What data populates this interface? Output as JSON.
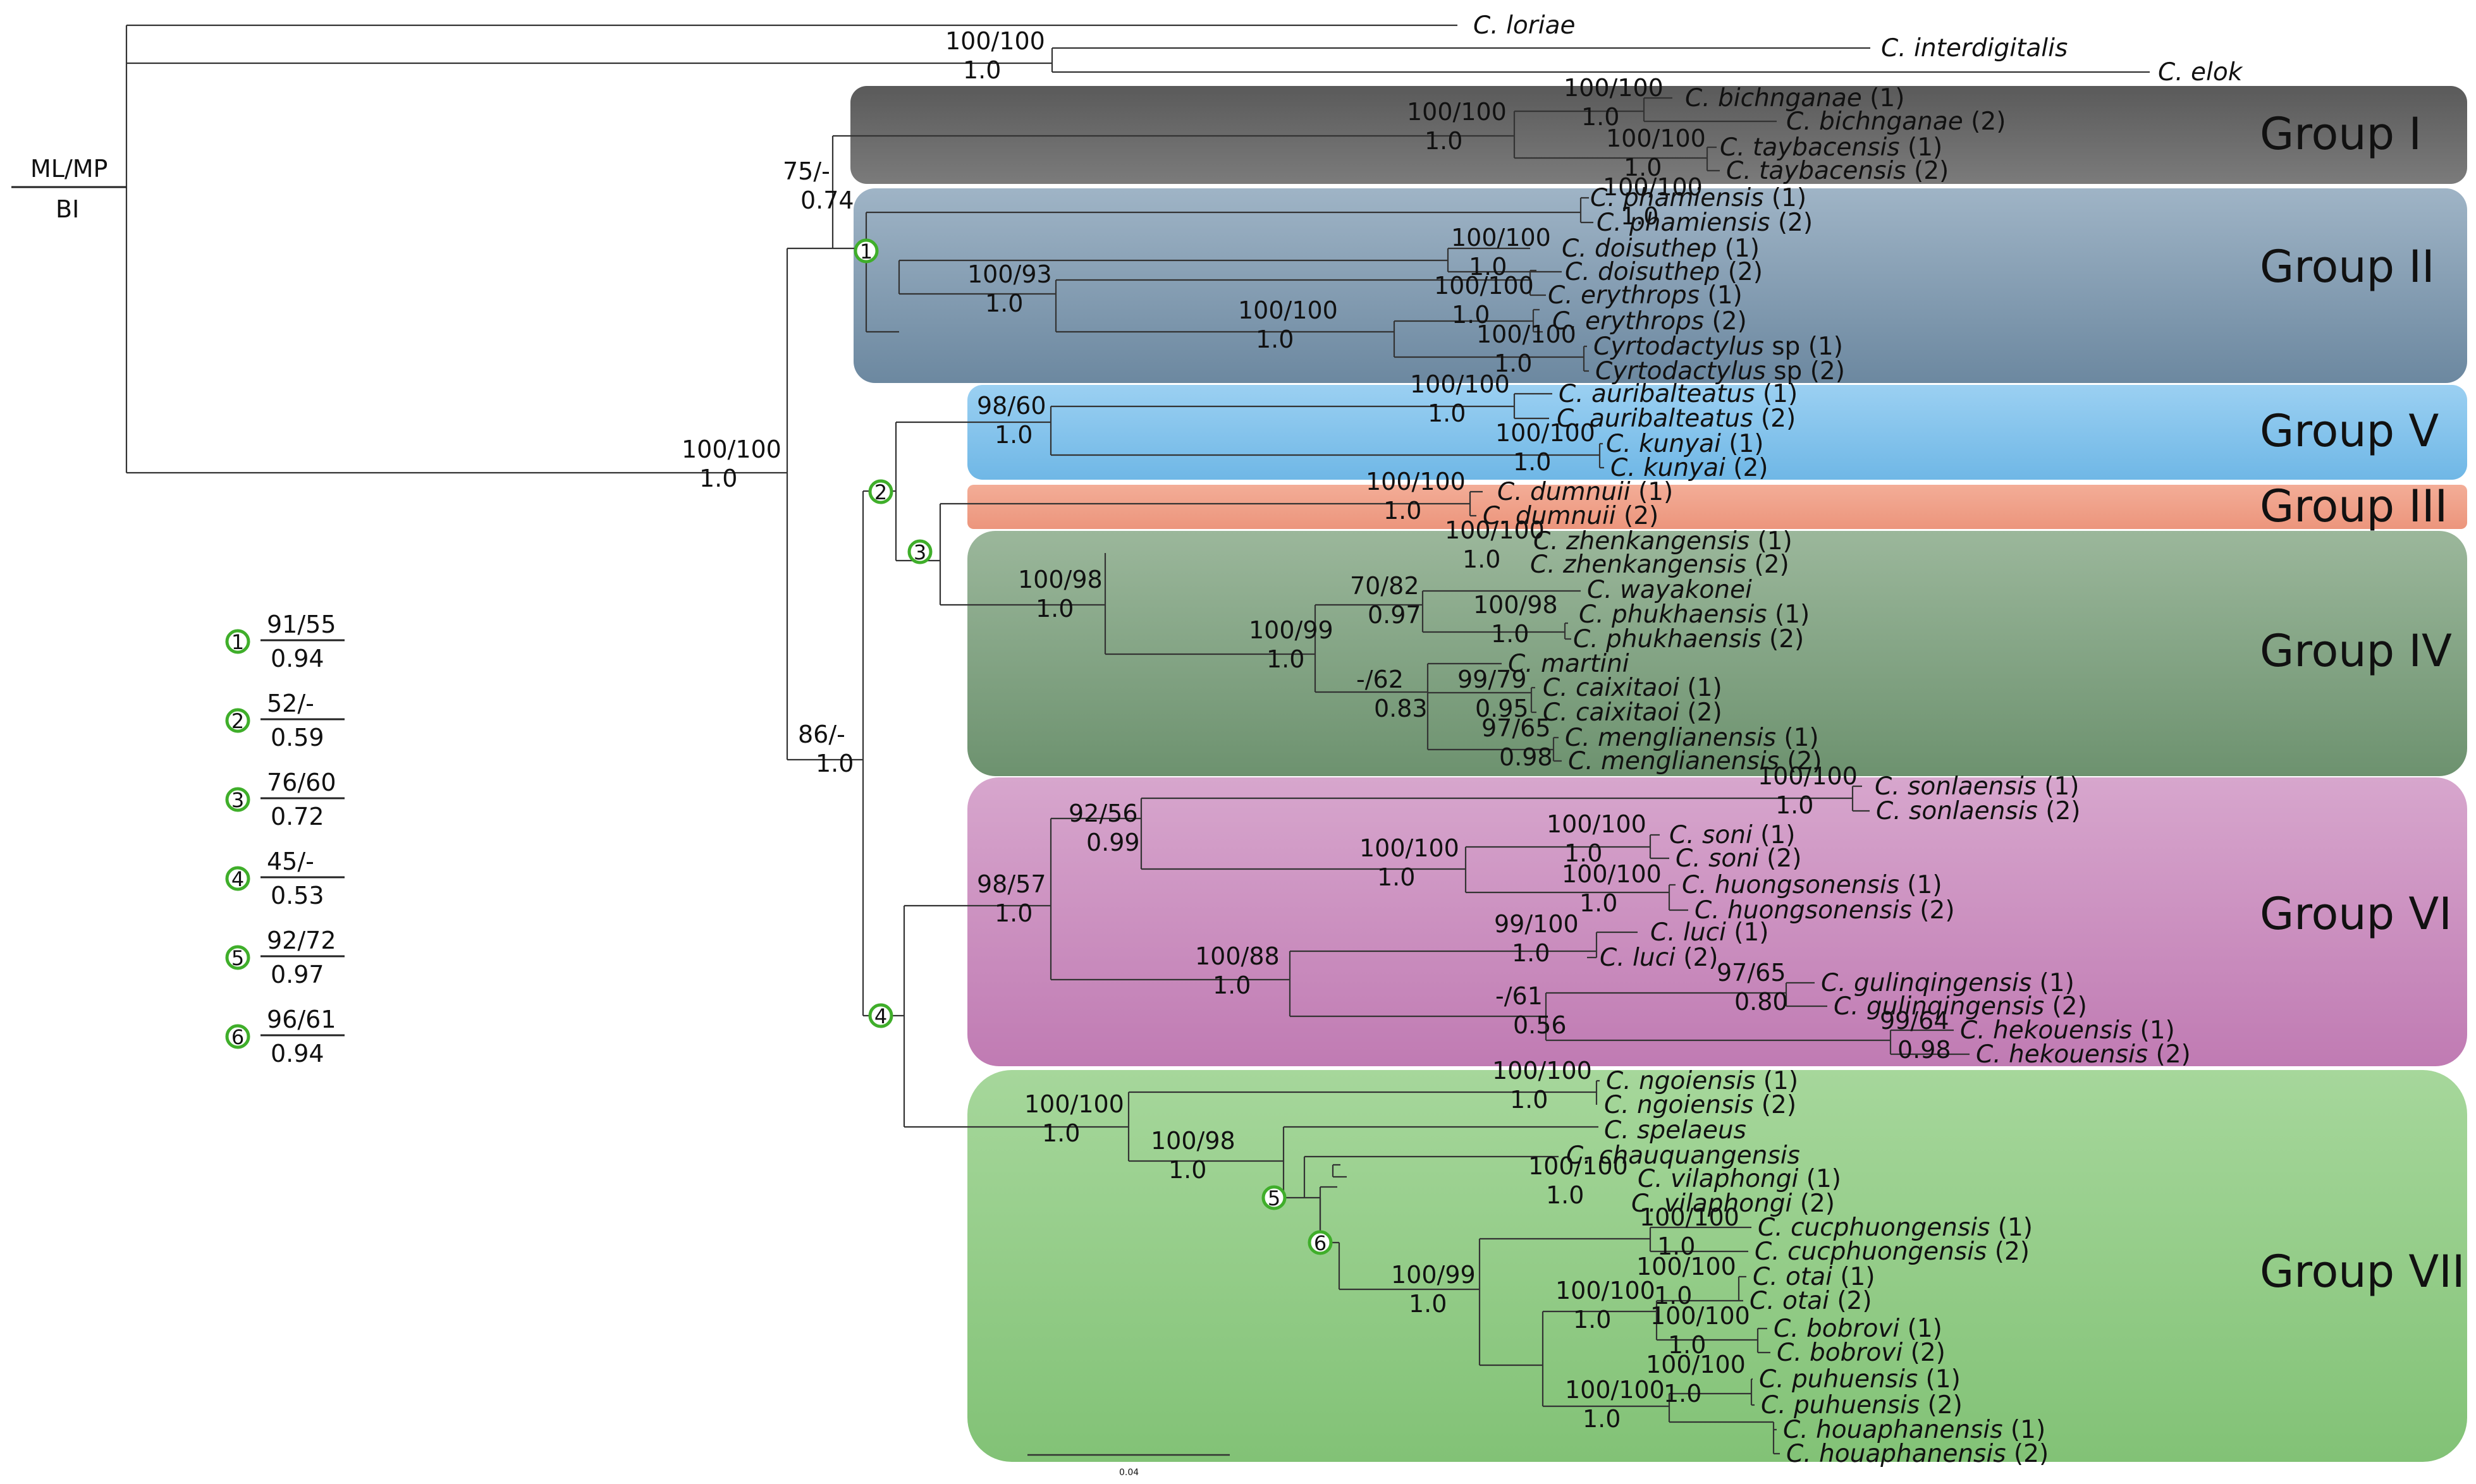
{
  "root_key": {
    "top": "ML/MP",
    "bottom": "BI"
  },
  "scale_bar": {
    "label": "0.04"
  },
  "legend": [
    {
      "num": "1",
      "top": "91/55",
      "bottom": "0.94"
    },
    {
      "num": "2",
      "top": "52/-",
      "bottom": "0.59"
    },
    {
      "num": "3",
      "top": "76/60",
      "bottom": "0.72"
    },
    {
      "num": "4",
      "top": "45/-",
      "bottom": "0.53"
    },
    {
      "num": "5",
      "top": "92/72",
      "bottom": "0.97"
    },
    {
      "num": "6",
      "top": "96/61",
      "bottom": "0.94"
    }
  ],
  "groups": [
    {
      "id": "g1",
      "label": "Group I",
      "color": "#6e6e6e"
    },
    {
      "id": "g2",
      "label": "Group II",
      "color": "#7f9ab0"
    },
    {
      "id": "g5",
      "label": "Group V",
      "color": "#7fc0ea"
    },
    {
      "id": "g3",
      "label": "Group III",
      "color": "#f0a38b"
    },
    {
      "id": "g4",
      "label": "Group IV",
      "color": "#84a886"
    },
    {
      "id": "g6",
      "label": "Group VI",
      "color": "#c98cbf"
    },
    {
      "id": "g7",
      "label": "Group VII",
      "color": "#8fcb84"
    }
  ],
  "taxa": [
    {
      "genus": "C.",
      "epithet": "loriae",
      "suffix": ""
    },
    {
      "genus": "C.",
      "epithet": "interdigitalis",
      "suffix": ""
    },
    {
      "genus": "C.",
      "epithet": "elok",
      "suffix": ""
    },
    {
      "genus": "C.",
      "epithet": "bichnganae",
      "suffix": " (1)"
    },
    {
      "genus": "C.",
      "epithet": "bichnganae",
      "suffix": " (2)"
    },
    {
      "genus": "C.",
      "epithet": "taybacensis",
      "suffix": " (1)"
    },
    {
      "genus": "C.",
      "epithet": "taybacensis",
      "suffix": " (2)"
    },
    {
      "genus": "C.",
      "epithet": "phamiensis",
      "suffix": " (1)"
    },
    {
      "genus": "C.",
      "epithet": "phamiensis",
      "suffix": " (2)"
    },
    {
      "genus": "C.",
      "epithet": "doisuthep",
      "suffix": " (1)"
    },
    {
      "genus": "C.",
      "epithet": "doisuthep",
      "suffix": " (2)"
    },
    {
      "genus": "C.",
      "epithet": "erythrops",
      "suffix": " (1)"
    },
    {
      "genus": "C.",
      "epithet": "erythrops",
      "suffix": " (2)"
    },
    {
      "genus": "Cyrtodactylus",
      "epithet": "",
      "suffix": " sp (1)"
    },
    {
      "genus": "Cyrtodactylus",
      "epithet": "",
      "suffix": " sp (2)"
    },
    {
      "genus": "C.",
      "epithet": "auribalteatus",
      "suffix": " (1)"
    },
    {
      "genus": "C.",
      "epithet": "auribalteatus",
      "suffix": " (2)"
    },
    {
      "genus": "C.",
      "epithet": "kunyai",
      "suffix": " (1)"
    },
    {
      "genus": "C.",
      "epithet": "kunyai",
      "suffix": " (2)"
    },
    {
      "genus": "C.",
      "epithet": "dumnuii",
      "suffix": " (1)"
    },
    {
      "genus": "C.",
      "epithet": "dumnuii",
      "suffix": " (2)"
    },
    {
      "genus": "C.",
      "epithet": "zhenkangensis",
      "suffix": " (1)"
    },
    {
      "genus": "C.",
      "epithet": "zhenkangensis",
      "suffix": " (2)"
    },
    {
      "genus": "C.",
      "epithet": "wayakonei",
      "suffix": ""
    },
    {
      "genus": "C.",
      "epithet": "phukhaensis",
      "suffix": " (1)"
    },
    {
      "genus": "C.",
      "epithet": "phukhaensis",
      "suffix": " (2)"
    },
    {
      "genus": "C.",
      "epithet": "martini",
      "suffix": ""
    },
    {
      "genus": "C.",
      "epithet": "caixitaoi",
      "suffix": " (1)"
    },
    {
      "genus": "C.",
      "epithet": "caixitaoi",
      "suffix": " (2)"
    },
    {
      "genus": "C.",
      "epithet": "menglianensis",
      "suffix": " (1)"
    },
    {
      "genus": "C.",
      "epithet": "menglianensis",
      "suffix": " (2)"
    },
    {
      "genus": "C.",
      "epithet": "sonlaensis",
      "suffix": " (1)"
    },
    {
      "genus": "C.",
      "epithet": "sonlaensis",
      "suffix": " (2)"
    },
    {
      "genus": "C.",
      "epithet": "soni",
      "suffix": " (1)"
    },
    {
      "genus": "C.",
      "epithet": "soni",
      "suffix": " (2)"
    },
    {
      "genus": "C.",
      "epithet": "huongsonensis",
      "suffix": " (1)"
    },
    {
      "genus": "C.",
      "epithet": "huongsonensis",
      "suffix": " (2)"
    },
    {
      "genus": "C.",
      "epithet": "luci",
      "suffix": " (1)"
    },
    {
      "genus": "C.",
      "epithet": "luci",
      "suffix": " (2)"
    },
    {
      "genus": "C.",
      "epithet": "gulinqingensis",
      "suffix": " (1)"
    },
    {
      "genus": "C.",
      "epithet": "gulinqingensis",
      "suffix": " (2)"
    },
    {
      "genus": "C.",
      "epithet": "hekouensis",
      "suffix": " (1)"
    },
    {
      "genus": "C.",
      "epithet": "hekouensis",
      "suffix": " (2)"
    },
    {
      "genus": "C.",
      "epithet": "ngoiensis",
      "suffix": " (1)"
    },
    {
      "genus": "C.",
      "epithet": "ngoiensis",
      "suffix": " (2)"
    },
    {
      "genus": "C.",
      "epithet": "spelaeus",
      "suffix": ""
    },
    {
      "genus": "C.",
      "epithet": "chauquangensis",
      "suffix": ""
    },
    {
      "genus": "C.",
      "epithet": "vilaphongi",
      "suffix": " (1)"
    },
    {
      "genus": "C.",
      "epithet": "vilaphongi",
      "suffix": " (2)"
    },
    {
      "genus": "C.",
      "epithet": "cucphuongensis",
      "suffix": " (1)"
    },
    {
      "genus": "C.",
      "epithet": "cucphuongensis",
      "suffix": " (2)"
    },
    {
      "genus": "C.",
      "epithet": "otai",
      "suffix": " (1)"
    },
    {
      "genus": "C.",
      "epithet": "otai",
      "suffix": " (2)"
    },
    {
      "genus": "C.",
      "epithet": "bobrovi",
      "suffix": " (1)"
    },
    {
      "genus": "C.",
      "epithet": "bobrovi",
      "suffix": " (2)"
    },
    {
      "genus": "C.",
      "epithet": "puhuensis",
      "suffix": " (1)"
    },
    {
      "genus": "C.",
      "epithet": "puhuensis",
      "suffix": " (2)"
    },
    {
      "genus": "C.",
      "epithet": "houaphanensis",
      "suffix": " (1)"
    },
    {
      "genus": "C.",
      "epithet": "houaphanensis",
      "suffix": " (2)"
    }
  ],
  "support": [
    {
      "top": "100/100",
      "bottom": "1.0"
    },
    {
      "top": "75/-",
      "bottom": "0.74"
    },
    {
      "top": "100/100",
      "bottom": "1.0"
    },
    {
      "top": "86/-",
      "bottom": "1.0"
    },
    {
      "top": "100/100",
      "bottom": "1.0"
    },
    {
      "top": "100/100",
      "bottom": "1.0"
    },
    {
      "top": "100/100",
      "bottom": "1.0"
    },
    {
      "top": "100/100",
      "bottom": "1.0"
    },
    {
      "top": "100/93",
      "bottom": "1.0"
    },
    {
      "top": "100/100",
      "bottom": "1.0"
    },
    {
      "top": "100/100",
      "bottom": "1.0"
    },
    {
      "top": "100/100",
      "bottom": "1.0"
    },
    {
      "top": "100/100",
      "bottom": "1.0"
    },
    {
      "top": "98/60",
      "bottom": "1.0"
    },
    {
      "top": "100/100",
      "bottom": "1.0"
    },
    {
      "top": "100/100",
      "bottom": "1.0"
    },
    {
      "top": "100/100",
      "bottom": "1.0"
    },
    {
      "top": "100/98",
      "bottom": "1.0"
    },
    {
      "top": "100/100",
      "bottom": "1.0"
    },
    {
      "top": "100/99",
      "bottom": "1.0"
    },
    {
      "top": "70/82",
      "bottom": "0.97"
    },
    {
      "top": "100/98",
      "bottom": "1.0"
    },
    {
      "top": "-/62",
      "bottom": "0.83"
    },
    {
      "top": "99/79",
      "bottom": "0.95"
    },
    {
      "top": "97/65",
      "bottom": "0.98"
    },
    {
      "top": "98/57",
      "bottom": "1.0"
    },
    {
      "top": "92/56",
      "bottom": "0.99"
    },
    {
      "top": "100/100",
      "bottom": "1.0"
    },
    {
      "top": "100/100",
      "bottom": "1.0"
    },
    {
      "top": "100/100",
      "bottom": "1.0"
    },
    {
      "top": "100/100",
      "bottom": "1.0"
    },
    {
      "top": "100/88",
      "bottom": "1.0"
    },
    {
      "top": "99/100",
      "bottom": "1.0"
    },
    {
      "top": "-/61",
      "bottom": "0.56"
    },
    {
      "top": "97/65",
      "bottom": "0.80"
    },
    {
      "top": "99/64",
      "bottom": "0.98"
    },
    {
      "top": "100/100",
      "bottom": "1.0"
    },
    {
      "top": "100/100",
      "bottom": "1.0"
    },
    {
      "top": "100/98",
      "bottom": "1.0"
    },
    {
      "top": "100/100",
      "bottom": "1.0"
    },
    {
      "top": "100/99",
      "bottom": "1.0"
    },
    {
      "top": "100/100",
      "bottom": "1.0"
    },
    {
      "top": "100/100",
      "bottom": "1.0"
    },
    {
      "top": "100/100",
      "bottom": "1.0"
    },
    {
      "top": "100/100",
      "bottom": "1.0"
    },
    {
      "top": "100/100",
      "bottom": "1.0"
    },
    {
      "top": "100/100",
      "bottom": "1.0"
    }
  ]
}
